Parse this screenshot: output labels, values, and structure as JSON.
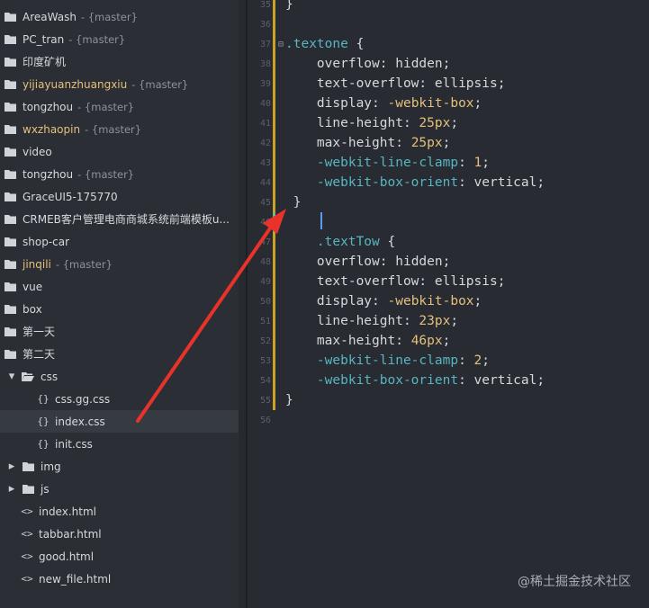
{
  "sidebar": {
    "items": [
      {
        "type": "folder",
        "name": "AreaWash",
        "branch": "- {master}",
        "modified": false,
        "depth": 0
      },
      {
        "type": "folder",
        "name": "PC_tran",
        "branch": "- {master}",
        "modified": false,
        "depth": 0
      },
      {
        "type": "folder",
        "name": "印度矿机",
        "branch": "",
        "modified": false,
        "depth": 0
      },
      {
        "type": "folder",
        "name": "yijiayuanzhuangxiu",
        "branch": "- {master}",
        "modified": true,
        "depth": 0
      },
      {
        "type": "folder",
        "name": "tongzhou",
        "branch": "- {master}",
        "modified": false,
        "depth": 0
      },
      {
        "type": "folder",
        "name": "wxzhaopin",
        "branch": "- {master}",
        "modified": true,
        "depth": 0
      },
      {
        "type": "folder",
        "name": "video",
        "branch": "",
        "modified": false,
        "depth": 0
      },
      {
        "type": "folder",
        "name": "tongzhou",
        "branch": "- {master}",
        "modified": false,
        "depth": 0
      },
      {
        "type": "folder",
        "name": "GraceUI5-175770",
        "branch": "",
        "modified": false,
        "depth": 0
      },
      {
        "type": "folder",
        "name": "CRMEB客户管理电商商城系统前端模板u...",
        "branch": "",
        "modified": false,
        "depth": 0
      },
      {
        "type": "folder",
        "name": "shop-car",
        "branch": "",
        "modified": false,
        "depth": 0
      },
      {
        "type": "folder",
        "name": "jinqili",
        "branch": "- {master}",
        "modified": true,
        "depth": 0
      },
      {
        "type": "folder",
        "name": "vue",
        "branch": "",
        "modified": false,
        "depth": 0
      },
      {
        "type": "folder",
        "name": "box",
        "branch": "",
        "modified": false,
        "depth": 0
      },
      {
        "type": "folder",
        "name": "第一天",
        "branch": "",
        "modified": false,
        "depth": 0
      },
      {
        "type": "folder",
        "name": "第二天",
        "branch": "",
        "modified": false,
        "depth": 0
      },
      {
        "type": "open-folder",
        "name": "css",
        "branch": "",
        "modified": false,
        "depth": 1
      },
      {
        "type": "css",
        "name": "css.gg.css",
        "branch": "",
        "modified": false,
        "depth": 2
      },
      {
        "type": "css",
        "name": "index.css",
        "branch": "",
        "modified": false,
        "depth": 2,
        "selected": true
      },
      {
        "type": "css",
        "name": "init.css",
        "branch": "",
        "modified": false,
        "depth": 2
      },
      {
        "type": "closed-folder",
        "name": "img",
        "branch": "",
        "modified": false,
        "depth": 1
      },
      {
        "type": "closed-folder",
        "name": "js",
        "branch": "",
        "modified": false,
        "depth": 1
      },
      {
        "type": "html",
        "name": "index.html",
        "branch": "",
        "modified": false,
        "depth": 1
      },
      {
        "type": "html",
        "name": "tabbar.html",
        "branch": "",
        "modified": false,
        "depth": 1
      },
      {
        "type": "html",
        "name": "good.html",
        "branch": "",
        "modified": false,
        "depth": 1
      },
      {
        "type": "html",
        "name": "new_file.html",
        "branch": "",
        "modified": false,
        "depth": 1
      }
    ],
    "css_icon": "{}",
    "html_icon": "<>"
  },
  "editor": {
    "lines": [
      {
        "n": "35",
        "fold": "",
        "text": "}",
        "kind": "plain",
        "mark": "yellow"
      },
      {
        "n": "36",
        "fold": "",
        "text": "",
        "kind": "plain",
        "mark": "yellow"
      },
      {
        "n": "37",
        "fold": "⊟",
        "text": ".textone {",
        "kind": "selector",
        "mark": "yellow"
      },
      {
        "n": "38",
        "fold": "",
        "text": "    overflow: hidden;",
        "kind": "prop",
        "mark": "yellow"
      },
      {
        "n": "39",
        "fold": "",
        "text": "    text-overflow: ellipsis;",
        "kind": "prop",
        "mark": "yellow"
      },
      {
        "n": "40",
        "fold": "",
        "text": "    display: -webkit-box;",
        "kind": "prop",
        "mark": "yellow"
      },
      {
        "n": "41",
        "fold": "",
        "text": "    line-height: 25px;",
        "kind": "prop",
        "mark": "yellow"
      },
      {
        "n": "42",
        "fold": "",
        "text": "    max-height: 25px;",
        "kind": "prop",
        "mark": "yellow"
      },
      {
        "n": "43",
        "fold": "",
        "text": "    -webkit-line-clamp: 1;",
        "kind": "prop",
        "mark": "yellow"
      },
      {
        "n": "44",
        "fold": "",
        "text": "    -webkit-box-orient: vertical;",
        "kind": "prop",
        "mark": "yellow"
      },
      {
        "n": "45",
        "fold": "",
        "text": " }",
        "kind": "plain",
        "mark": "yellow"
      },
      {
        "n": "46",
        "fold": "",
        "text": "",
        "kind": "plain",
        "mark": "green"
      },
      {
        "n": "47",
        "fold": "",
        "text": "    .textTow {",
        "kind": "selector",
        "mark": "yellow"
      },
      {
        "n": "48",
        "fold": "",
        "text": "    overflow: hidden;",
        "kind": "prop",
        "mark": "yellow"
      },
      {
        "n": "49",
        "fold": "",
        "text": "    text-overflow: ellipsis;",
        "kind": "prop",
        "mark": "yellow"
      },
      {
        "n": "50",
        "fold": "",
        "text": "    display: -webkit-box;",
        "kind": "prop",
        "mark": "yellow"
      },
      {
        "n": "51",
        "fold": "",
        "text": "    line-height: 23px;",
        "kind": "prop",
        "mark": "yellow"
      },
      {
        "n": "52",
        "fold": "",
        "text": "    max-height: 46px;",
        "kind": "prop",
        "mark": "yellow"
      },
      {
        "n": "53",
        "fold": "",
        "text": "    -webkit-line-clamp: 2;",
        "kind": "prop",
        "mark": "yellow"
      },
      {
        "n": "54",
        "fold": "",
        "text": "    -webkit-box-orient: vertical;",
        "kind": "prop",
        "mark": "yellow"
      },
      {
        "n": "55",
        "fold": "",
        "text": "}",
        "kind": "plain",
        "mark": "yellow"
      },
      {
        "n": "56",
        "fold": "",
        "text": "",
        "kind": "plain",
        "mark": ""
      }
    ]
  },
  "watermark": "@稀土掘金技术社区",
  "colors": {
    "arrow": "#e8322a",
    "modified_mark": "#c9a227",
    "added_mark": "#77b88a",
    "cursor": "#5b9bf0"
  }
}
